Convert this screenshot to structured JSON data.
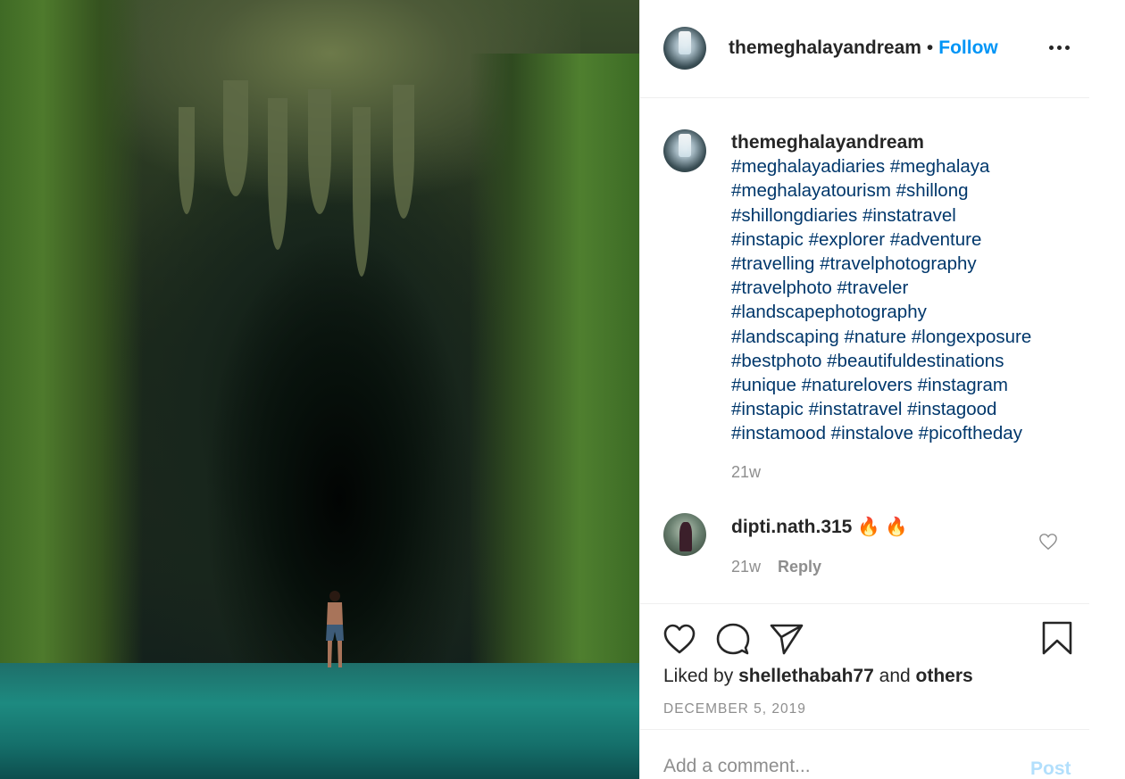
{
  "post": {
    "author": "themeghalayandream",
    "separator": "•",
    "follow_label": "Follow",
    "more_icon": "more-horizontal-icon",
    "image_alt": "cave-waterfall-photo"
  },
  "caption": {
    "username": "themeghalayandream",
    "hashtags": "#meghalayadiaries #meghalaya\n#meghalayatourism #shillong\n#shillongdiaries #instatravel\n#instapic #explorer #adventure\n#travelling #travelphotography\n#travelphoto #traveler\n#landscapephotography\n#landscaping #nature #longexposure\n#bestphoto #beautifuldestinations\n#unique #naturelovers #instagram\n#instapic #instatravel #instagood\n#instamood #instalove #picoftheday",
    "age": "21w"
  },
  "comments": [
    {
      "username": "dipti.nath.315",
      "text": "🔥 🔥",
      "age": "21w",
      "reply_label": "Reply",
      "like_icon": "heart-outline-icon"
    }
  ],
  "actions": {
    "like_icon": "heart-outline-icon",
    "comment_icon": "comment-bubble-icon",
    "share_icon": "paper-plane-icon",
    "save_icon": "bookmark-icon"
  },
  "likes": {
    "prefix": "Liked by",
    "user": "shellethabah77",
    "conjunction": "and",
    "others": "others"
  },
  "date": "DECEMBER 5, 2019",
  "add_comment": {
    "placeholder": "Add a comment...",
    "post_label": "Post"
  }
}
